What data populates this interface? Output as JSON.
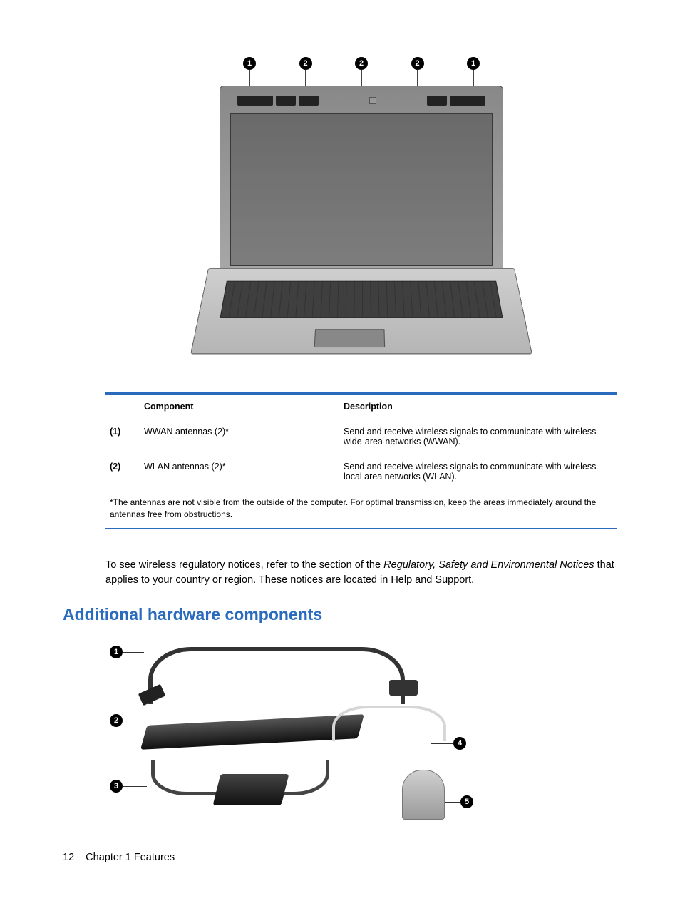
{
  "figure1": {
    "callouts": [
      "1",
      "2",
      "2",
      "2",
      "1"
    ]
  },
  "table": {
    "headers": {
      "component": "Component",
      "description": "Description"
    },
    "rows": [
      {
        "id": "(1)",
        "name": "WWAN antennas (2)*",
        "desc": "Send and receive wireless signals to communicate with wireless wide-area networks (WWAN)."
      },
      {
        "id": "(2)",
        "name": "WLAN antennas (2)*",
        "desc": "Send and receive wireless signals to communicate with wireless local area networks (WLAN)."
      }
    ],
    "footnote": "*The antennas are not visible from the outside of the computer. For optimal transmission, keep the areas immediately around the antennas free from obstructions."
  },
  "paragraph": {
    "pre": "To see wireless regulatory notices, refer to the section of the ",
    "em": "Regulatory, Safety and Environmental Notices",
    "post": " that applies to your country or region. These notices are located in Help and Support."
  },
  "heading": "Additional hardware components",
  "figure2": {
    "callouts": [
      "1",
      "2",
      "3",
      "4",
      "5"
    ]
  },
  "footer": {
    "page": "12",
    "chapter": "Chapter 1   Features"
  }
}
